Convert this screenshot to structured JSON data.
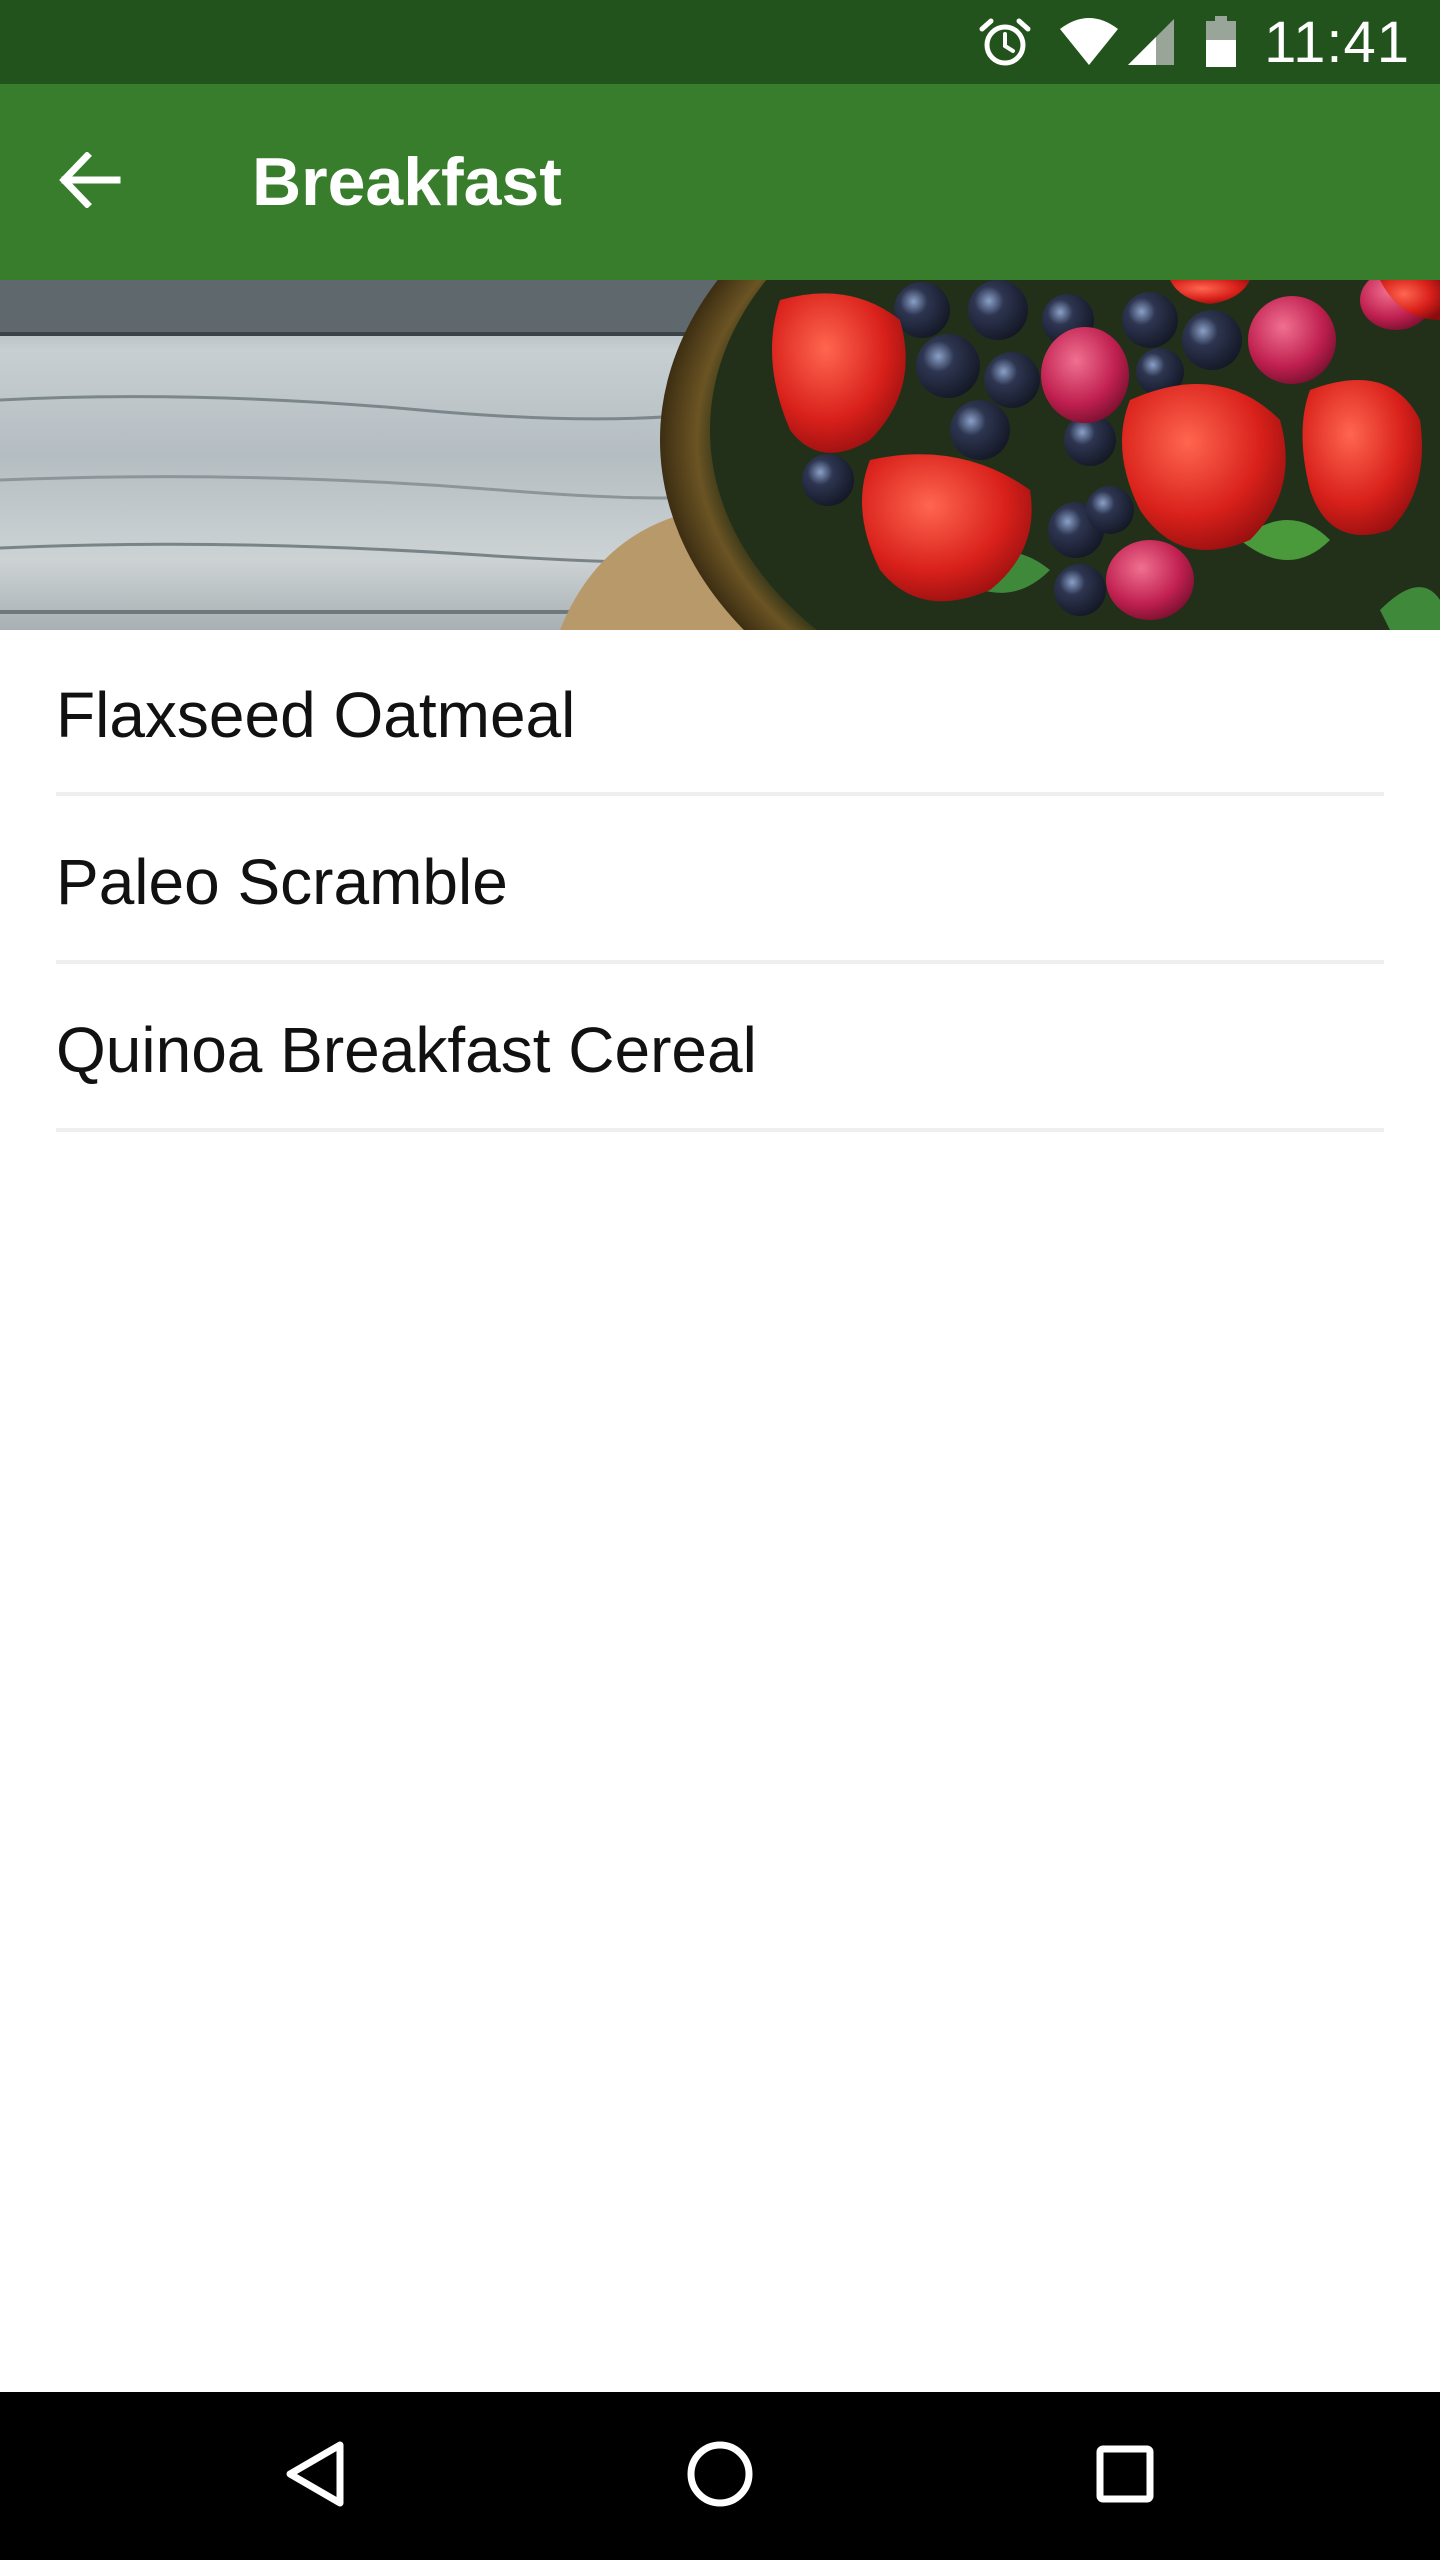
{
  "status_bar": {
    "time": "11:41",
    "icons": [
      "alarm-icon",
      "wifi-icon",
      "cell-signal-icon",
      "battery-icon"
    ],
    "background": "#23531c"
  },
  "app_bar": {
    "title": "Breakfast",
    "back_icon": "arrow-back-icon",
    "background": "#377d2b"
  },
  "banner": {
    "image": "berries-basket-on-wood"
  },
  "recipes": [
    {
      "label": "Flaxseed Oatmeal"
    },
    {
      "label": "Paleo Scramble"
    },
    {
      "label": "Quinoa Breakfast Cereal"
    }
  ],
  "nav_bar": {
    "icons": [
      "back-triangle-icon",
      "home-circle-icon",
      "recents-square-icon"
    ]
  }
}
